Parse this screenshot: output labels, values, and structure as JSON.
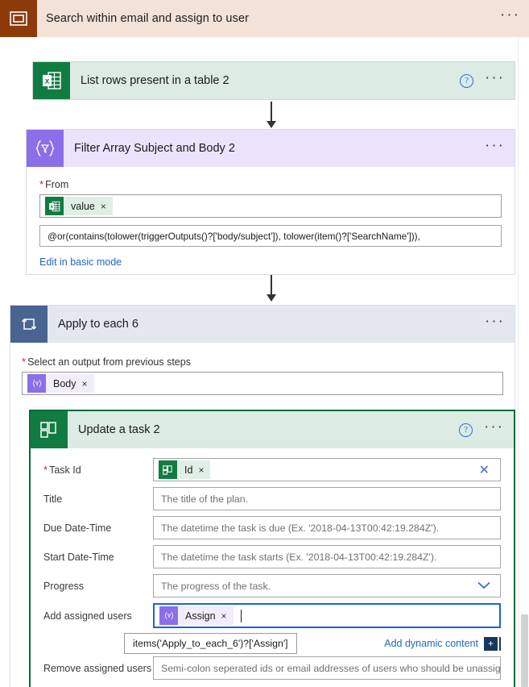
{
  "flow_header": {
    "icon": "flow-window-icon",
    "title": "Search within email and assign to user",
    "menu": "···",
    "icon_bg": "#8C3A09",
    "bar_bg": "#F3E2D8"
  },
  "nodes": [
    {
      "id": "list-rows",
      "title": "List rows present in a table 2",
      "icon": "excel-icon",
      "header_bg": "#DCEBE3",
      "icon_bg": "#107C41",
      "help": "?",
      "menu": "···"
    },
    {
      "id": "filter-array",
      "title": "Filter Array Subject and Body 2",
      "icon": "filter-braces-icon",
      "header_bg": "#EAE3FB",
      "icon_bg": "#8A6FE8",
      "menu": "···",
      "from_label": "From",
      "from_required": "*",
      "from_token": {
        "label": "value",
        "remove": "×",
        "icon": "excel-icon"
      },
      "expression": "@or(contains(tolower(triggerOutputs()?['body/subject']), tolower(item()?['SearchName'])),",
      "basic_mode_link": "Edit in basic mode"
    },
    {
      "id": "apply-to-each",
      "title": "Apply to each 6",
      "icon": "loop-icon",
      "header_bg": "#E3E8EF",
      "icon_bg": "#4A6491",
      "menu": "···",
      "output_label": "Select an output from previous steps",
      "output_required": "*",
      "output_token": {
        "label": "Body",
        "remove": "×",
        "icon": "filter-braces-icon"
      }
    },
    {
      "id": "update-task",
      "title": "Update a task 2",
      "icon": "planner-icon",
      "header_bg": "#DCEBE3",
      "icon_bg": "#107C41",
      "border_color": "#0B6A3A",
      "help": "?",
      "menu": "···"
    }
  ],
  "update_task_form": {
    "rows": [
      {
        "label": "Task Id",
        "required": "*",
        "type": "token",
        "token": {
          "label": "Id",
          "remove": "×",
          "icon": "planner-icon"
        },
        "clear": "✕"
      },
      {
        "label": "Title",
        "required": "",
        "type": "text",
        "placeholder": "The title of the plan."
      },
      {
        "label": "Due Date-Time",
        "required": "",
        "type": "text",
        "placeholder": "The datetime the task is due (Ex. '2018-04-13T00:42:19.284Z')."
      },
      {
        "label": "Start Date-Time",
        "required": "",
        "type": "text",
        "placeholder": "The datetime the task starts (Ex. '2018-04-13T00:42:19.284Z')."
      },
      {
        "label": "Progress",
        "required": "",
        "type": "select",
        "placeholder": "The progress of the task.",
        "chevron": "⌄"
      },
      {
        "label": "Add assigned users",
        "required": "",
        "type": "token-focused",
        "token": {
          "label": "Assign",
          "remove": "×",
          "icon": "filter-braces-icon"
        }
      },
      {
        "label": "Remove assigned users",
        "required": "",
        "type": "text",
        "placeholder": "Semi-colon seperated ids or email addresses of users who should be unassigne"
      }
    ],
    "tooltip": "items('Apply_to_each_6')?['Assign']",
    "dynamic_content_link": "Add dynamic content",
    "dynamic_content_plus": "+"
  },
  "colors": {
    "excel_green": "#107C41",
    "planner_green": "#107C41",
    "flow_purple": "#8A6FE8",
    "loop_blue": "#4A6491",
    "link_blue": "#2266c4",
    "focus_blue": "#1a62d6",
    "required_red": "#c0272d",
    "update_border_green": "#0B6A3A"
  }
}
